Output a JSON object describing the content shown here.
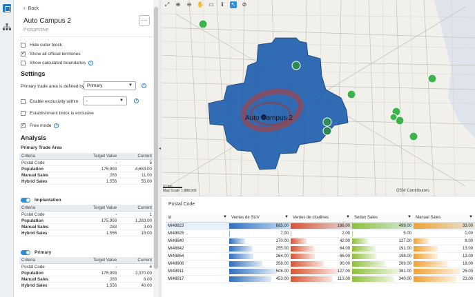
{
  "panel": {
    "back_label": "Back",
    "title": "Auto Campus 2",
    "subtitle": "Prospective",
    "more_label": "···",
    "options": [
      {
        "label": "Hide outer block",
        "checked": false
      },
      {
        "label": "Show all official territories",
        "checked": true
      },
      {
        "label": "Show calculated boundaries",
        "checked": false
      }
    ],
    "settings_heading": "Settings",
    "primary_area_label": "Primary trade area is defined by",
    "primary_area_value": "Primary",
    "exclusivity_label": "Enable exclusivity within",
    "exclusivity_value": "-",
    "establishment_label": "Establishment block is exclusive",
    "free_mode_label": "Free mode",
    "analysis_heading": "Analysis",
    "pta_heading": "Primary Trade Area",
    "columns": [
      "Criteria",
      "Target Value",
      "Current"
    ],
    "pta_rows": [
      [
        "Postal Code",
        "-",
        "5",
        false
      ],
      [
        "Population",
        "175,993",
        "4,653.00",
        true
      ],
      [
        "Manual Sales",
        "283",
        "11.00",
        true
      ],
      [
        "Hybrid Sales",
        "1,556",
        "55.00",
        true
      ]
    ],
    "implantation_label": "Implantation",
    "implantation_rows": [
      [
        "Postal Code",
        "-",
        "1",
        false
      ],
      [
        "Population",
        "175,993",
        "1,283.00",
        true
      ],
      [
        "Manual Sales",
        "283",
        "3.00",
        true
      ],
      [
        "Hybrid Sales",
        "1,556",
        "15.00",
        true
      ]
    ],
    "primary_label": "Primary",
    "primary_rows": [
      [
        "Postal Code",
        "-",
        "4",
        false
      ],
      [
        "Population",
        "175,993",
        "3,370.00",
        true
      ],
      [
        "Manual Sales",
        "283",
        "8.00",
        true
      ],
      [
        "Hybrid Sales",
        "1,556",
        "40.00",
        true
      ]
    ]
  },
  "map": {
    "label": "Auto Campus 2",
    "scale_text": "21 km\nMap Scale: 1:888,566",
    "attribution": "OSM Contributors",
    "toolbar_icons": [
      "expand-icon",
      "zoom-in-icon",
      "zoom-out-icon",
      "pan-hand-icon",
      "ruler-icon",
      "info-icon",
      "select-cursor-icon",
      "clear-icon"
    ],
    "colors": {
      "territory": "#1f5fae",
      "heat": "#c0392b",
      "marker": "#3cb44b"
    }
  },
  "grid": {
    "title": "Postal Code",
    "columns": [
      "Id",
      "Ventes de SUV",
      "Ventes de citadines",
      "Sedan Sales",
      "Manual Sales"
    ],
    "bar_colors": [
      "#2f6fbf",
      "#d9532f",
      "#8dbf3a",
      "#f0a030"
    ],
    "max": [
      665,
      166,
      499,
      33
    ],
    "rows": [
      {
        "id": "MI48823",
        "values": [
          665.0,
          166.0,
          499.0,
          33.0
        ],
        "display": [
          "665.00",
          "166.00",
          "499.00",
          "33.00"
        ]
      },
      {
        "id": "MI48825",
        "values": [
          7.0,
          2.0,
          5.0,
          0.0
        ],
        "display": [
          "7.00",
          "2.00",
          "5.00",
          "0.00"
        ]
      },
      {
        "id": "MI48840",
        "values": [
          170.0,
          42.0,
          127.0,
          8.0
        ],
        "display": [
          "170.00",
          "42.00",
          "127.00",
          "8.00"
        ]
      },
      {
        "id": "MI48842",
        "values": [
          255.0,
          64.0,
          191.0,
          13.0
        ],
        "display": [
          "255.00",
          "64.00",
          "191.00",
          "13.00"
        ]
      },
      {
        "id": "MI48864",
        "values": [
          264.0,
          66.0,
          198.0,
          13.0
        ],
        "display": [
          "264.00",
          "66.00",
          "198.00",
          "13.00"
        ]
      },
      {
        "id": "MI48906",
        "values": [
          358.0,
          90.0,
          269.0,
          18.0
        ],
        "display": [
          "358.00",
          "90.00",
          "269.00",
          "18.00"
        ]
      },
      {
        "id": "MI48911",
        "values": [
          508.0,
          127.0,
          381.0,
          25.0
        ],
        "display": [
          "508.00",
          "127.00",
          "381.00",
          "25.00"
        ]
      },
      {
        "id": "MI48917",
        "values": [
          453.0,
          113.0,
          340.0,
          23.0
        ],
        "display": [
          "453.00",
          "113.00",
          "340.00",
          "23.00"
        ]
      }
    ]
  }
}
